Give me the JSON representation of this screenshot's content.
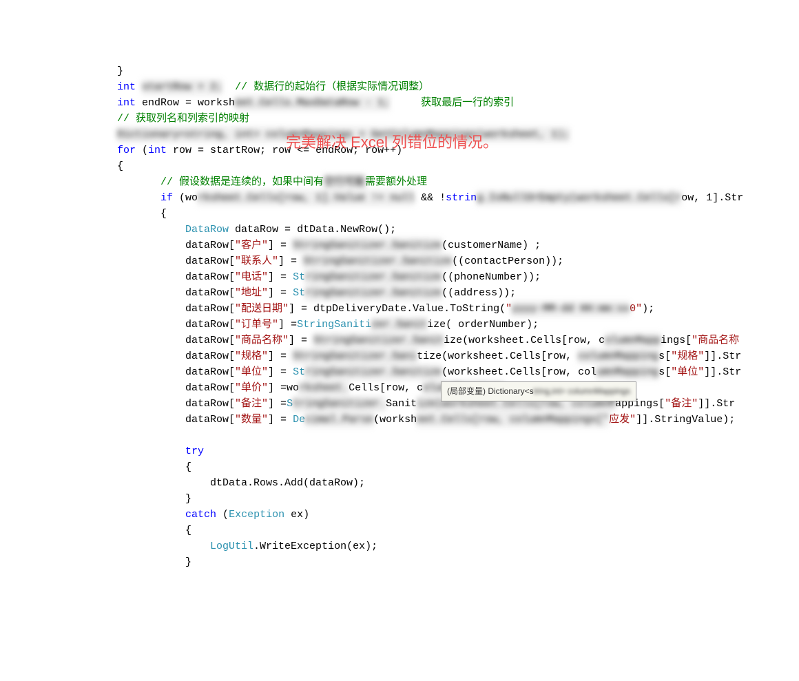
{
  "overlay": "完美解决 Excel 列错位的情况。",
  "tooltip_prefix": "(局部变量) Dictionary<s",
  "lines": [
    {
      "indent": 0,
      "content": "}"
    },
    {
      "indent": 0,
      "content": ""
    },
    {
      "indent": 0,
      "parts": [
        {
          "t": "keyword",
          "v": "int"
        },
        {
          "t": "plain",
          "v": " "
        },
        {
          "t": "blur",
          "v": "startRow = 2;"
        },
        {
          "t": "plain",
          "v": "  "
        },
        {
          "t": "comment",
          "v": "// 数据行的起始行（根据实际情况调整）"
        }
      ]
    },
    {
      "indent": 0,
      "parts": [
        {
          "t": "keyword",
          "v": "int"
        },
        {
          "t": "plain",
          "v": " endRow = worksh"
        },
        {
          "t": "blur",
          "v": "eet.Cells.MaxDataRow - 1;"
        },
        {
          "t": "plain",
          "v": "     "
        },
        {
          "t": "comment",
          "v": "获取最后一行的索引"
        }
      ]
    },
    {
      "indent": 0,
      "content": ""
    },
    {
      "indent": 0,
      "parts": [
        {
          "t": "comment",
          "v": "// 获取列名和列索引的映射"
        }
      ]
    },
    {
      "indent": 0,
      "parts": [
        {
          "t": "blur",
          "v": "Dictionary<string, int> columnMappings = GetColumnMappings(worksheet, 1);"
        }
      ]
    },
    {
      "indent": 0,
      "parts": [
        {
          "t": "keyword",
          "v": "for"
        },
        {
          "t": "plain",
          "v": " ("
        },
        {
          "t": "keyword",
          "v": "int"
        },
        {
          "t": "plain",
          "v": " row = startRow; row <= endRow; row++)"
        }
      ]
    },
    {
      "indent": 0,
      "content": "{"
    },
    {
      "indent": 0,
      "content": ""
    },
    {
      "indent": 1,
      "parts": [
        {
          "t": "comment",
          "v": "// 假设数据是连续的，如果中间有"
        },
        {
          "t": "blur",
          "v": "空行可能"
        },
        {
          "t": "comment",
          "v": "需要额外处理"
        }
      ]
    },
    {
      "indent": 1,
      "parts": [
        {
          "t": "keyword",
          "v": "if"
        },
        {
          "t": "plain",
          "v": " (wo"
        },
        {
          "t": "blur",
          "v": "rksheet.Cells[row, 1].Value != null"
        },
        {
          "t": "plain",
          "v": " && !"
        },
        {
          "t": "keyword",
          "v": "strin"
        },
        {
          "t": "blur",
          "v": "g.IsNullOrEmpty(worksheet.Cells[r"
        },
        {
          "t": "plain",
          "v": "ow, 1].Str"
        }
      ]
    },
    {
      "indent": 1,
      "content": "{"
    },
    {
      "indent": 2,
      "parts": [
        {
          "t": "type",
          "v": "DataRow"
        },
        {
          "t": "plain",
          "v": " dataRow = dtData.NewRow();"
        }
      ]
    },
    {
      "indent": 2,
      "parts": [
        {
          "t": "plain",
          "v": "dataRow["
        },
        {
          "t": "string",
          "v": "\"客户\""
        },
        {
          "t": "plain",
          "v": "] = "
        },
        {
          "t": "blur",
          "v": "StringSanitizer.Sanitize"
        },
        {
          "t": "plain",
          "v": "(customerName) ;"
        }
      ]
    },
    {
      "indent": 2,
      "parts": [
        {
          "t": "plain",
          "v": "dataRow["
        },
        {
          "t": "string",
          "v": "\"联系人\""
        },
        {
          "t": "plain",
          "v": "] = "
        },
        {
          "t": "blur",
          "v": "StringSanitizer.Sanitize"
        },
        {
          "t": "plain",
          "v": "((contactPerson));"
        }
      ]
    },
    {
      "indent": 2,
      "parts": [
        {
          "t": "plain",
          "v": "dataRow["
        },
        {
          "t": "string",
          "v": "\"电话\""
        },
        {
          "t": "plain",
          "v": "] = "
        },
        {
          "t": "type",
          "v": "St"
        },
        {
          "t": "blur",
          "v": "ringSanitizer.Sanitize"
        },
        {
          "t": "plain",
          "v": "((phoneNumber));"
        }
      ]
    },
    {
      "indent": 2,
      "parts": [
        {
          "t": "plain",
          "v": "dataRow["
        },
        {
          "t": "string",
          "v": "\"地址\""
        },
        {
          "t": "plain",
          "v": "] = "
        },
        {
          "t": "type",
          "v": "St"
        },
        {
          "t": "blur",
          "v": "ringSanitizer.Sanitize"
        },
        {
          "t": "plain",
          "v": "((address));"
        }
      ]
    },
    {
      "indent": 2,
      "parts": [
        {
          "t": "plain",
          "v": "dataRow["
        },
        {
          "t": "string",
          "v": "\"配送日期\""
        },
        {
          "t": "plain",
          "v": "] = dtpDeliveryDate.Value.ToString("
        },
        {
          "t": "string",
          "v": "\""
        },
        {
          "t": "blur",
          "v": "yyyy-MM-dd HH:mm:ss"
        },
        {
          "t": "string",
          "v": "0\""
        },
        {
          "t": "plain",
          "v": ");"
        }
      ]
    },
    {
      "indent": 2,
      "parts": [
        {
          "t": "plain",
          "v": "dataRow["
        },
        {
          "t": "string",
          "v": "\"订单号\""
        },
        {
          "t": "plain",
          "v": "] ="
        },
        {
          "t": "type",
          "v": "StringSaniti"
        },
        {
          "t": "blur",
          "v": "zer.Sanit"
        },
        {
          "t": "plain",
          "v": "ize( orderNumber);"
        }
      ]
    },
    {
      "indent": 2,
      "parts": [
        {
          "t": "plain",
          "v": "dataRow["
        },
        {
          "t": "string",
          "v": "\"商品名称\""
        },
        {
          "t": "plain",
          "v": "] = "
        },
        {
          "t": "blur",
          "v": "StringSanitizer.Sanit"
        },
        {
          "t": "plain",
          "v": "ize(worksheet.Cells[row, c"
        },
        {
          "t": "blur",
          "v": "olumnMapp"
        },
        {
          "t": "plain",
          "v": "ings["
        },
        {
          "t": "string",
          "v": "\"商品名称"
        }
      ]
    },
    {
      "indent": 2,
      "parts": [
        {
          "t": "plain",
          "v": "dataRow["
        },
        {
          "t": "string",
          "v": "\"规格\""
        },
        {
          "t": "plain",
          "v": "] = "
        },
        {
          "t": "blur",
          "v": "StringSanitizer.Sani"
        },
        {
          "t": "plain",
          "v": "tize(worksheet.Cells[row, "
        },
        {
          "t": "blur",
          "v": "columnMapping"
        },
        {
          "t": "plain",
          "v": "s["
        },
        {
          "t": "string",
          "v": "\"规格\""
        },
        {
          "t": "plain",
          "v": "]].Str"
        }
      ]
    },
    {
      "indent": 2,
      "parts": [
        {
          "t": "plain",
          "v": "dataRow["
        },
        {
          "t": "string",
          "v": "\"单位\""
        },
        {
          "t": "plain",
          "v": "] = "
        },
        {
          "t": "type",
          "v": "St"
        },
        {
          "t": "blur",
          "v": "ringSanitizer.Sanitize"
        },
        {
          "t": "plain",
          "v": "(worksheet.Cells[row, col"
        },
        {
          "t": "blur",
          "v": "umnMapping"
        },
        {
          "t": "plain",
          "v": "s["
        },
        {
          "t": "string",
          "v": "\"单位\""
        },
        {
          "t": "plain",
          "v": "]].Str"
        }
      ]
    },
    {
      "indent": 2,
      "parts": [
        {
          "t": "plain",
          "v": "dataRow["
        },
        {
          "t": "string",
          "v": "\"单价\""
        },
        {
          "t": "plain",
          "v": "] =wo"
        },
        {
          "t": "blur",
          "v": "rksheet."
        },
        {
          "t": "plain",
          "v": "Cells[row, c"
        },
        {
          "t": "blur",
          "v": "olumnMappings"
        },
        {
          "t": "plain",
          "v": "["
        },
        {
          "t": "string",
          "v": "\"单价\""
        },
        {
          "t": "plain",
          "v": "]].StringValue;"
        }
      ]
    },
    {
      "indent": 2,
      "parts": [
        {
          "t": "plain",
          "v": "dataRow["
        },
        {
          "t": "string",
          "v": "\"备注\""
        },
        {
          "t": "plain",
          "v": "] ="
        },
        {
          "t": "type",
          "v": "S"
        },
        {
          "t": "blur",
          "v": "tringSanitizer."
        },
        {
          "t": "plain",
          "v": "Sanit"
        },
        {
          "t": "blur",
          "v": "ize(worksheet.Cells[row, columnM"
        },
        {
          "t": "plain",
          "v": "appings["
        },
        {
          "t": "string",
          "v": "\"备注\""
        },
        {
          "t": "plain",
          "v": "]].Str"
        }
      ]
    },
    {
      "indent": 2,
      "parts": [
        {
          "t": "plain",
          "v": "dataRow["
        },
        {
          "t": "string",
          "v": "\"数量\""
        },
        {
          "t": "plain",
          "v": "] = "
        },
        {
          "t": "type",
          "v": "De"
        },
        {
          "t": "blur",
          "v": "cimal.Parse"
        },
        {
          "t": "plain",
          "v": "(worksh"
        },
        {
          "t": "blur",
          "v": "eet.Cells[row, columnMappings[\""
        },
        {
          "t": "string",
          "v": "应发\""
        },
        {
          "t": "plain",
          "v": "]].StringValue);"
        }
      ]
    },
    {
      "indent": 2,
      "content": ""
    },
    {
      "indent": 2,
      "parts": [
        {
          "t": "keyword",
          "v": "try"
        }
      ]
    },
    {
      "indent": 2,
      "content": "{"
    },
    {
      "indent": 3,
      "parts": [
        {
          "t": "plain",
          "v": "dtData.Rows.Add(dataRow);"
        }
      ]
    },
    {
      "indent": 2,
      "content": "}"
    },
    {
      "indent": 2,
      "parts": [
        {
          "t": "keyword",
          "v": "catch"
        },
        {
          "t": "plain",
          "v": " ("
        },
        {
          "t": "type",
          "v": "Exception"
        },
        {
          "t": "plain",
          "v": " ex)"
        }
      ]
    },
    {
      "indent": 2,
      "content": "{"
    },
    {
      "indent": 3,
      "parts": [
        {
          "t": "type",
          "v": "LogUtil"
        },
        {
          "t": "plain",
          "v": ".WriteException(ex);"
        }
      ]
    },
    {
      "indent": 2,
      "content": "}"
    }
  ]
}
